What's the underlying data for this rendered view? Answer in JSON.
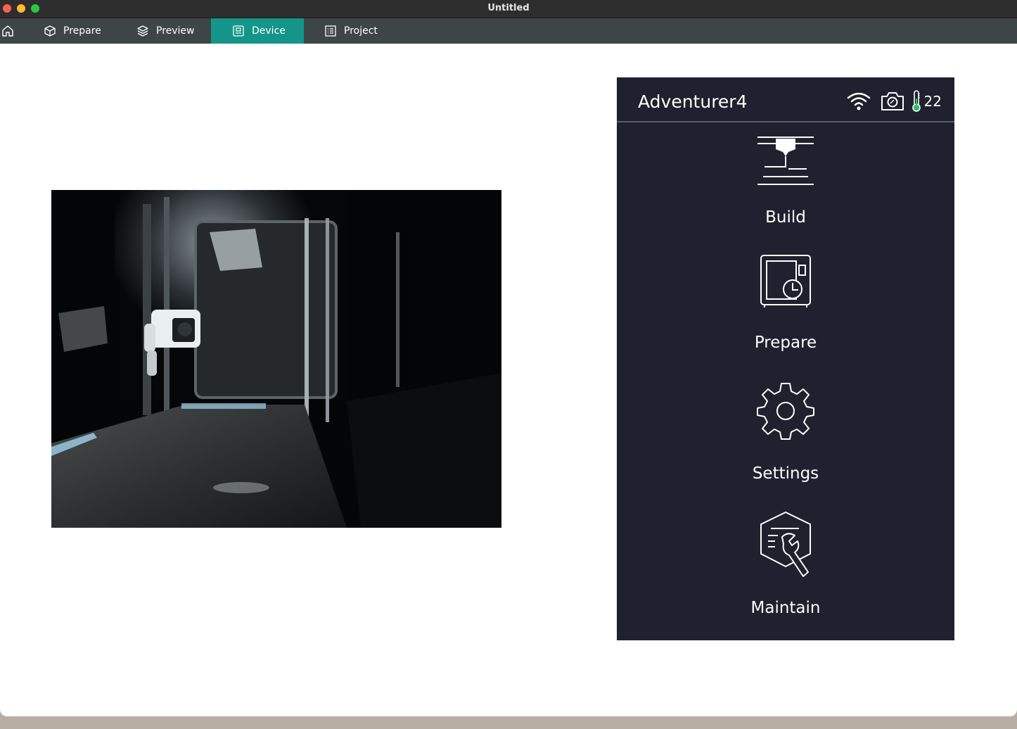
{
  "window": {
    "title": "Untitled"
  },
  "tabs": [
    {
      "label": "Prepare",
      "icon": "cube-icon",
      "active": false
    },
    {
      "label": "Preview",
      "icon": "layers-icon",
      "active": false
    },
    {
      "label": "Device",
      "icon": "device-icon",
      "active": true
    },
    {
      "label": "Project",
      "icon": "list-icon",
      "active": false
    }
  ],
  "home": {
    "icon": "home-icon"
  },
  "device_panel": {
    "printer_name": "Adventurer4",
    "status": {
      "wifi_icon": "wifi-icon",
      "camera_icon": "camera-icon",
      "thermometer_icon": "thermometer-icon",
      "temperature": "22"
    },
    "menu": [
      {
        "label": "Build",
        "icon": "build-icon"
      },
      {
        "label": "Prepare",
        "icon": "prepare-icon"
      },
      {
        "label": "Settings",
        "icon": "settings-gear-icon"
      },
      {
        "label": "Maintain",
        "icon": "maintain-icon"
      }
    ]
  },
  "colors": {
    "accent": "#159589",
    "tabbar": "#3e4547",
    "panel": "#20202f"
  }
}
